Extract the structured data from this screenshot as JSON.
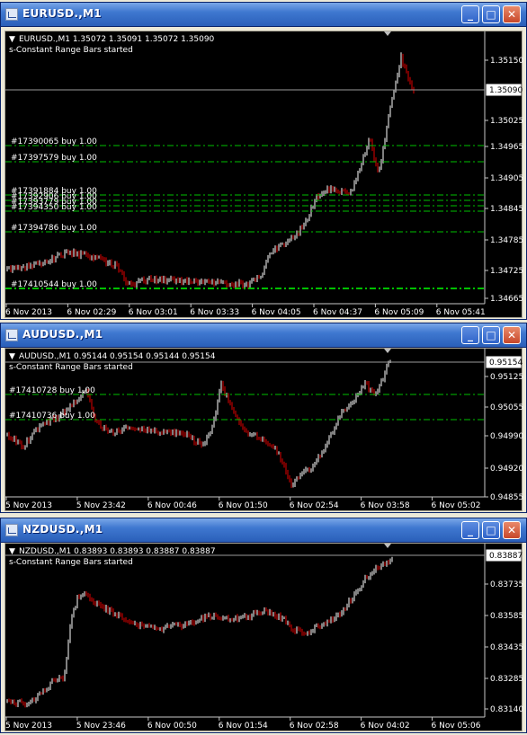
{
  "colors": {
    "order_line": "#00c000",
    "bar_up": "#ffffff",
    "bar_down": "#e00000",
    "background": "#000000"
  },
  "windows": [
    {
      "title": "EURUSD.,M1",
      "header": "EURUSD.,M1  1.35072 1.35091 1.35072 1.35090",
      "indicator": "s-Constant Range Bars started",
      "current_price": "1.35090",
      "y_ticks": [
        "1.35150",
        "1.35025",
        "1.34965",
        "1.34905",
        "1.34845",
        "1.34785",
        "1.34725",
        "1.34665"
      ],
      "x_ticks": [
        "6 Nov 2013",
        "6 Nov 02:29",
        "6 Nov 03:01",
        "6 Nov 03:33",
        "6 Nov 04:05",
        "6 Nov 04:37",
        "6 Nov 05:09",
        "6 Nov 05:41"
      ],
      "orders": [
        {
          "label": "#17390065 buy 1.00",
          "price": 1.34975
        },
        {
          "label": "#17397579 buy 1.00",
          "price": 1.34945
        },
        {
          "label": "#17391884 buy 1.00",
          "price": 1.34875
        },
        {
          "label": "#17392906 buy 1.00",
          "price": 1.34865
        },
        {
          "label": "#17393779 buy 1.00",
          "price": 1.34855
        },
        {
          "label": "#17394350 buy 1.00",
          "price": 1.34845
        },
        {
          "label": "#17394786 buy 1.00",
          "price": 1.34795
        },
        {
          "label": "#17410544 buy 1.00",
          "price": 1.34695
        }
      ]
    },
    {
      "title": "AUDUSD.,M1",
      "header": "AUDUSD.,M1  0.95144 0.95154 0.95144 0.95154",
      "indicator": "s-Constant Range Bars started",
      "current_price": "0.95154",
      "y_ticks": [
        "0.95125",
        "0.95055",
        "0.94990",
        "0.94920",
        "0.94855"
      ],
      "x_ticks": [
        "5 Nov 2013",
        "5 Nov 23:42",
        "6 Nov 00:46",
        "6 Nov 01:50",
        "6 Nov 02:54",
        "6 Nov 03:58",
        "6 Nov 05:02"
      ],
      "orders": [
        {
          "label": "#17410728 buy 1.00",
          "price": 0.95085
        },
        {
          "label": "#17410736 buy 1.00",
          "price": 0.95035
        }
      ]
    },
    {
      "title": "NZDUSD.,M1",
      "header": "NZDUSD.,M1  0.83893 0.83893 0.83887 0.83887",
      "indicator": "s-Constant Range Bars started",
      "current_price": "0.83887",
      "y_ticks": [
        "0.83735",
        "0.83585",
        "0.83435",
        "0.83285",
        "0.83140"
      ],
      "x_ticks": [
        "5 Nov 2013",
        "5 Nov 23:46",
        "6 Nov 00:50",
        "6 Nov 01:54",
        "6 Nov 02:58",
        "6 Nov 04:02",
        "6 Nov 05:06"
      ],
      "orders": []
    }
  ]
}
